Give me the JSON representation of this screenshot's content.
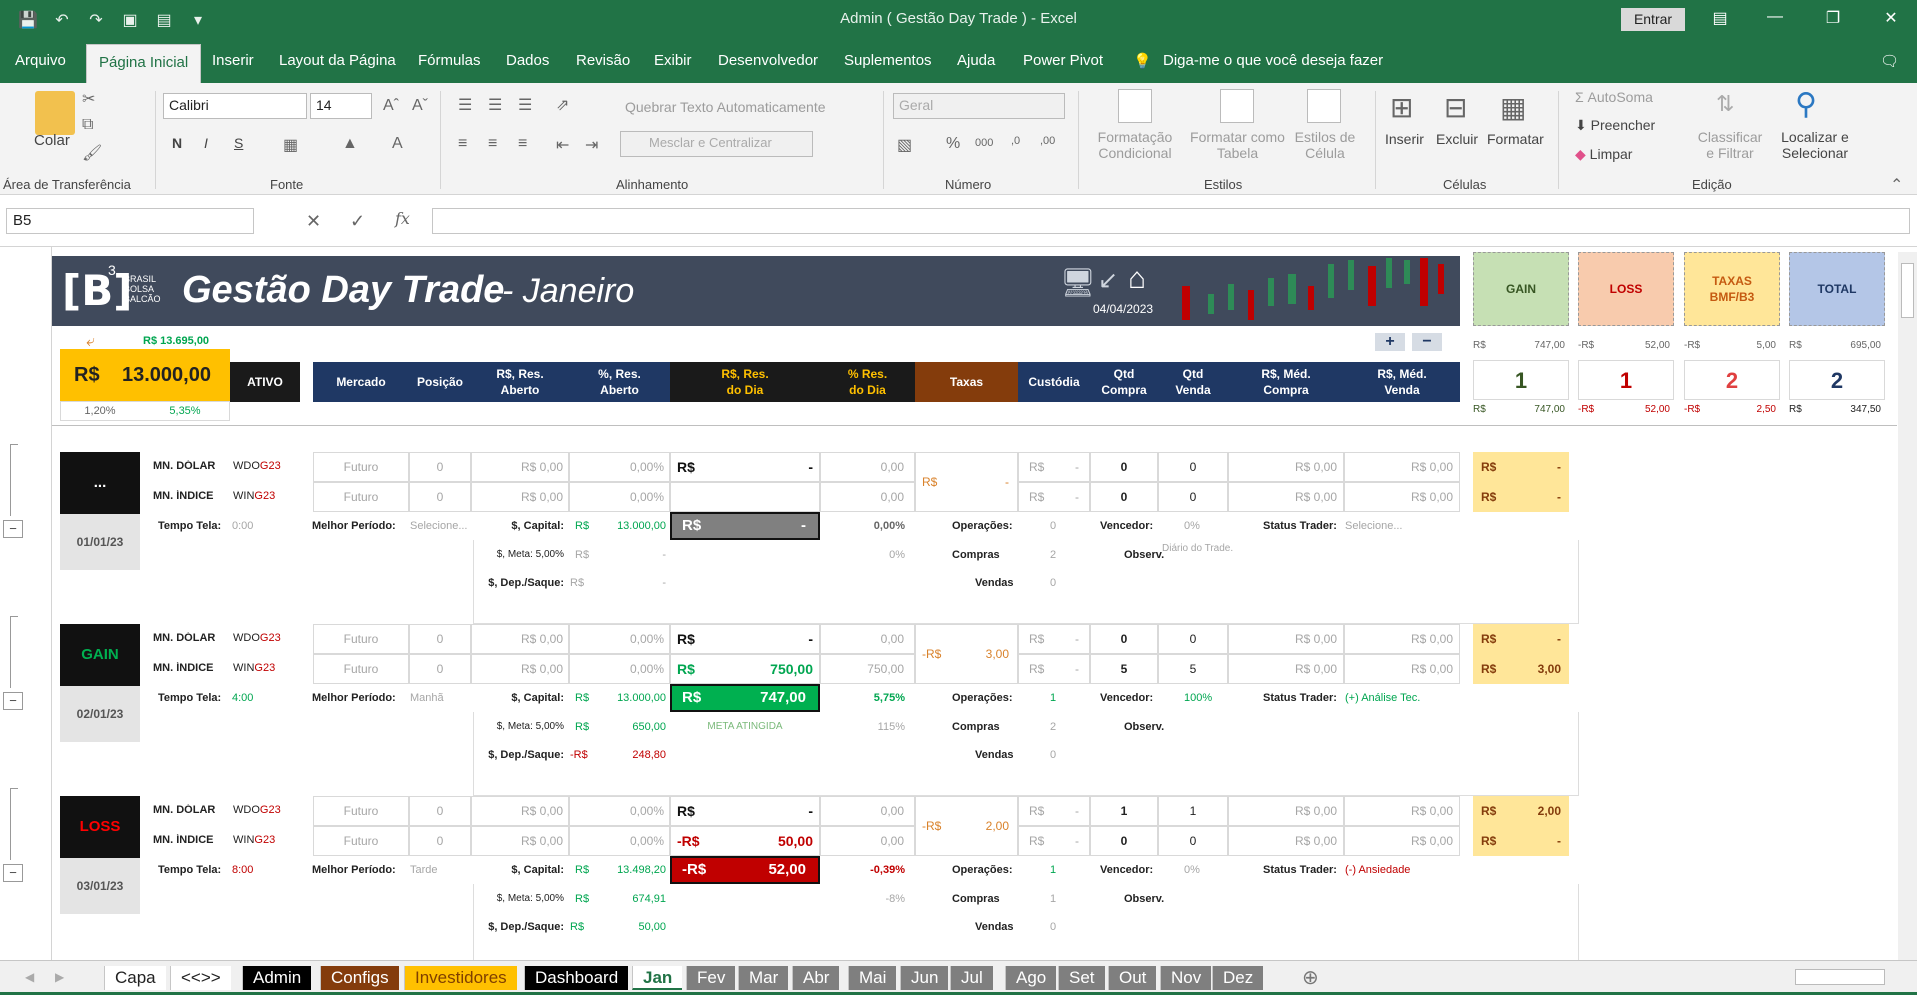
{
  "window": {
    "title": "Admin ( Gestão Day Trade )  -  Excel",
    "signin": "Entrar"
  },
  "menu": {
    "items": [
      "Arquivo",
      "Página Inicial",
      "Inserir",
      "Layout da Página",
      "Fórmulas",
      "Dados",
      "Revisão",
      "Exibir",
      "Desenvolvedor",
      "Suplementos",
      "Ajuda",
      "Power Pivot"
    ],
    "tell_me": "Diga-me o que você deseja fazer"
  },
  "ribbon": {
    "clipboard": {
      "paste": "Colar",
      "label": "Área de Transferência"
    },
    "font": {
      "name": "Calibri",
      "size": "14",
      "bold": "N",
      "italic": "I",
      "underline": "S",
      "label": "Fonte"
    },
    "alignment": {
      "wrap": "Quebrar Texto Automaticamente",
      "merge": "Mesclar e Centralizar",
      "label": "Alinhamento"
    },
    "number": {
      "format": "Geral",
      "label": "Número"
    },
    "styles": {
      "cond1": "Formatação",
      "cond2": "Condicional",
      "table1": "Formatar como",
      "table2": "Tabela",
      "cell1": "Estilos de",
      "cell2": "Célula",
      "label": "Estilos"
    },
    "cells": {
      "insert": "Inserir",
      "delete": "Excluir",
      "format": "Formatar",
      "label": "Células"
    },
    "editing": {
      "autosum": "AutoSoma",
      "fill": "Preencher",
      "clear": "Limpar",
      "sort1": "Classificar",
      "sort2": "e Filtrar",
      "find1": "Localizar e",
      "find2": "Selecionar",
      "label": "Edição"
    }
  },
  "formula_bar": {
    "name_box": "B5",
    "fx": "fx"
  },
  "banner": {
    "logo": "[B]",
    "logo_sup": "3",
    "logo_text": [
      "BRASIL",
      "BOLSA",
      "BALCÃO"
    ],
    "title": "Gestão Day Trade",
    "month": "- Janeiro",
    "date": "04/04/2023"
  },
  "summary": {
    "cards": [
      {
        "title": "GAIN",
        "count": "1",
        "top_cur": "R$",
        "top_val": "747,00",
        "bot_cur": "R$",
        "bot_val": "747,00",
        "bg": "#c6e0b4",
        "color": "#375623"
      },
      {
        "title": "LOSS",
        "count": "1",
        "top_cur": "-R$",
        "top_val": "52,00",
        "bot_cur": "-R$",
        "bot_val": "52,00",
        "bg": "#f8cbad",
        "color": "#c00000"
      },
      {
        "title": "TAXAS BMF/B3",
        "count": "2",
        "top_cur": "-R$",
        "top_val": "5,00",
        "bot_cur": "-R$",
        "bot_val": "2,50",
        "bg": "#ffe699",
        "color": "#c00000"
      },
      {
        "title": "TOTAL",
        "count": "2",
        "top_cur": "R$",
        "top_val": "695,00",
        "bot_cur": "R$",
        "bot_val": "347,50",
        "bg": "#b4c6e7",
        "color": "#1f3864"
      }
    ]
  },
  "capital": {
    "top": "R$ 13.695,00",
    "cur": "R$",
    "value": "13.000,00",
    "pct1": "1,20%",
    "pct2": "5,35%",
    "ativo": "ATIVO"
  },
  "headers": [
    {
      "l1": "Mercado",
      "l2": ""
    },
    {
      "l1": "Posição",
      "l2": ""
    },
    {
      "l1": "R$, Res.",
      "l2": "Aberto"
    },
    {
      "l1": "%, Res.",
      "l2": "Aberto"
    },
    {
      "l1": "R$, Res.",
      "l2": "do Dia"
    },
    {
      "l1": "% Res.",
      "l2": "do Dia"
    },
    {
      "l1": "Taxas",
      "l2": ""
    },
    {
      "l1": "Custódia",
      "l2": ""
    },
    {
      "l1": "Qtd",
      "l2": "Compra"
    },
    {
      "l1": "Qtd",
      "l2": "Venda"
    },
    {
      "l1": "R$, Méd.",
      "l2": "Compra"
    },
    {
      "l1": "R$, Méd.",
      "l2": "Venda"
    }
  ],
  "days": [
    {
      "status": "...",
      "status_color": "#ffffff",
      "date": "01/01/23",
      "rows": [
        {
          "label": "MN. DÓLAR",
          "ticker": "WDO",
          "code": "G23",
          "mercado": "Futuro",
          "pos": "0",
          "res_ab": "R$ 0,00",
          "pct_ab": "0,00%",
          "resdia_cur": "R$",
          "resdia": "-",
          "pctdia": "0,00",
          "cust": "R$",
          "cust_v": "-",
          "qc": "0",
          "qv": "0",
          "mc": "R$ 0,00",
          "mv": "R$ 0,00",
          "tx_cur": "R$",
          "tx": "-"
        },
        {
          "label": "MN. ÍNDICE",
          "ticker": "WIN",
          "code": "G23",
          "mercado": "Futuro",
          "pos": "0",
          "res_ab": "R$ 0,00",
          "pct_ab": "0,00%",
          "resdia_cur": "",
          "resdia": "",
          "pctdia": "0,00",
          "cust": "R$",
          "cust_v": "-",
          "qc": "0",
          "qv": "0",
          "mc": "R$ 0,00",
          "mv": "R$ 0,00",
          "tx_cur": "R$",
          "tx": "-"
        }
      ],
      "taxas_cur": "R$",
      "taxas": "-",
      "tempo_label": "Tempo Tela:",
      "tempo": "0:00",
      "periodo_label": "Melhor Período:",
      "periodo": "Selecione...",
      "capital_label": "$, Capital:",
      "capital_cur": "R$",
      "capital": "13.000,00",
      "total_cur": "R$",
      "total": "-",
      "total_pct": "0,00%",
      "total_bg": "#808080",
      "meta_label": "$, Meta: 5,00%",
      "meta_cur": "R$",
      "meta": "-",
      "meta_note": "",
      "meta_pct": "0%",
      "dep_label": "$, Dep./Saque:",
      "dep_cur": "R$",
      "dep": "-",
      "op_label": "Operações:",
      "op": "0",
      "compras_label": "Compras",
      "compras": "2",
      "vendas_label": "Vendas",
      "vendas": "0",
      "venc_label": "Vencedor:",
      "venc": "0%",
      "obs_label": "Observ.",
      "obs": "Diário do Trade.",
      "st_label": "Status Trader:",
      "st": "Selecione..."
    },
    {
      "status": "GAIN",
      "status_color": "#00b050",
      "date": "02/01/23",
      "rows": [
        {
          "label": "MN. DÓLAR",
          "ticker": "WDO",
          "code": "G23",
          "mercado": "Futuro",
          "pos": "0",
          "res_ab": "R$ 0,00",
          "pct_ab": "0,00%",
          "resdia_cur": "R$",
          "resdia": "-",
          "pctdia": "0,00",
          "cust": "R$",
          "cust_v": "-",
          "qc": "0",
          "qv": "0",
          "mc": "R$ 0,00",
          "mv": "R$ 0,00",
          "tx_cur": "R$",
          "tx": "-"
        },
        {
          "label": "MN. ÍNDICE",
          "ticker": "WIN",
          "code": "G23",
          "mercado": "Futuro",
          "pos": "0",
          "res_ab": "R$ 0,00",
          "pct_ab": "0,00%",
          "resdia_cur": "R$",
          "resdia": "750,00",
          "pctdia": "750,00",
          "cust": "R$",
          "cust_v": "-",
          "qc": "5",
          "qv": "5",
          "mc": "R$ 0,00",
          "mv": "R$ 0,00",
          "tx_cur": "R$",
          "tx": "3,00"
        }
      ],
      "taxas_cur": "-R$",
      "taxas": "3,00",
      "tempo_label": "Tempo Tela:",
      "tempo": "4:00",
      "periodo_label": "Melhor Período:",
      "periodo": "Manhã",
      "capital_label": "$, Capital:",
      "capital_cur": "R$",
      "capital": "13.000,00",
      "total_cur": "R$",
      "total": "747,00",
      "total_pct": "5,75%",
      "total_bg": "#00b050",
      "meta_label": "$, Meta: 5,00%",
      "meta_cur": "R$",
      "meta": "650,00",
      "meta_note": "META ATINGIDA",
      "meta_pct": "115%",
      "dep_label": "$, Dep./Saque:",
      "dep_cur": "-R$",
      "dep": "248,80",
      "op_label": "Operações:",
      "op": "1",
      "compras_label": "Compras",
      "compras": "2",
      "vendas_label": "Vendas",
      "vendas": "0",
      "venc_label": "Vencedor:",
      "venc": "100%",
      "obs_label": "Observ.",
      "obs": "",
      "st_label": "Status Trader:",
      "st": "(+) Análise Tec."
    },
    {
      "status": "LOSS",
      "status_color": "#ff0000",
      "date": "03/01/23",
      "rows": [
        {
          "label": "MN. DÓLAR",
          "ticker": "WDO",
          "code": "G23",
          "mercado": "Futuro",
          "pos": "0",
          "res_ab": "R$ 0,00",
          "pct_ab": "0,00%",
          "resdia_cur": "R$",
          "resdia": "-",
          "pctdia": "0,00",
          "cust": "R$",
          "cust_v": "-",
          "qc": "1",
          "qv": "1",
          "mc": "R$ 0,00",
          "mv": "R$ 0,00",
          "tx_cur": "R$",
          "tx": "2,00"
        },
        {
          "label": "MN. ÍNDICE",
          "ticker": "WIN",
          "code": "G23",
          "mercado": "Futuro",
          "pos": "0",
          "res_ab": "R$ 0,00",
          "pct_ab": "0,00%",
          "resdia_cur": "-R$",
          "resdia": "50,00",
          "pctdia": "0,00",
          "cust": "R$",
          "cust_v": "-",
          "qc": "0",
          "qv": "0",
          "mc": "R$ 0,00",
          "mv": "R$ 0,00",
          "tx_cur": "R$",
          "tx": "-"
        }
      ],
      "taxas_cur": "-R$",
      "taxas": "2,00",
      "tempo_label": "Tempo Tela:",
      "tempo": "8:00",
      "periodo_label": "Melhor Período:",
      "periodo": "Tarde",
      "capital_label": "$, Capital:",
      "capital_cur": "R$",
      "capital": "13.498,20",
      "total_cur": "-R$",
      "total": "52,00",
      "total_pct": "-0,39%",
      "total_bg": "#c00000",
      "meta_label": "$, Meta: 5,00%",
      "meta_cur": "R$",
      "meta": "674,91",
      "meta_note": "",
      "meta_pct": "-8%",
      "dep_label": "$, Dep./Saque:",
      "dep_cur": "R$",
      "dep": "50,00",
      "op_label": "Operações:",
      "op": "1",
      "compras_label": "Compras",
      "compras": "1",
      "vendas_label": "Vendas",
      "vendas": "0",
      "venc_label": "Vencedor:",
      "venc": "0%",
      "obs_label": "Observ.",
      "obs": "",
      "st_label": "Status Trader:",
      "st": "(-) Ansiedade"
    }
  ],
  "tabs": [
    {
      "label": "Capa",
      "bg": "#ffffff",
      "color": "#222"
    },
    {
      "label": "<<>>",
      "bg": "#ffffff",
      "color": "#222"
    },
    {
      "label": "Admin",
      "bg": "#000000",
      "color": "#ffffff"
    },
    {
      "label": "Configs",
      "bg": "#843c0c",
      "color": "#ffffff"
    },
    {
      "label": "Investidores",
      "bg": "#ffc000",
      "color": "#7f3f00"
    },
    {
      "label": "Dashboard",
      "bg": "#000000",
      "color": "#ffffff"
    },
    {
      "label": "Jan",
      "bg": "#ffffff",
      "color": "#217346"
    },
    {
      "label": "Fev",
      "bg": "#7f7f7f",
      "color": "#ffffff"
    },
    {
      "label": "Mar",
      "bg": "#7f7f7f",
      "color": "#ffffff"
    },
    {
      "label": "Abr",
      "bg": "#7f7f7f",
      "color": "#ffffff"
    },
    {
      "label": "Mai",
      "bg": "#7f7f7f",
      "color": "#ffffff"
    },
    {
      "label": "Jun",
      "bg": "#7f7f7f",
      "color": "#ffffff"
    },
    {
      "label": "Jul",
      "bg": "#7f7f7f",
      "color": "#ffffff"
    },
    {
      "label": "Ago",
      "bg": "#7f7f7f",
      "color": "#ffffff"
    },
    {
      "label": "Set",
      "bg": "#7f7f7f",
      "color": "#ffffff"
    },
    {
      "label": "Out",
      "bg": "#7f7f7f",
      "color": "#ffffff"
    },
    {
      "label": "Nov",
      "bg": "#7f7f7f",
      "color": "#ffffff"
    },
    {
      "label": "Dez",
      "bg": "#7f7f7f",
      "color": "#ffffff"
    }
  ]
}
